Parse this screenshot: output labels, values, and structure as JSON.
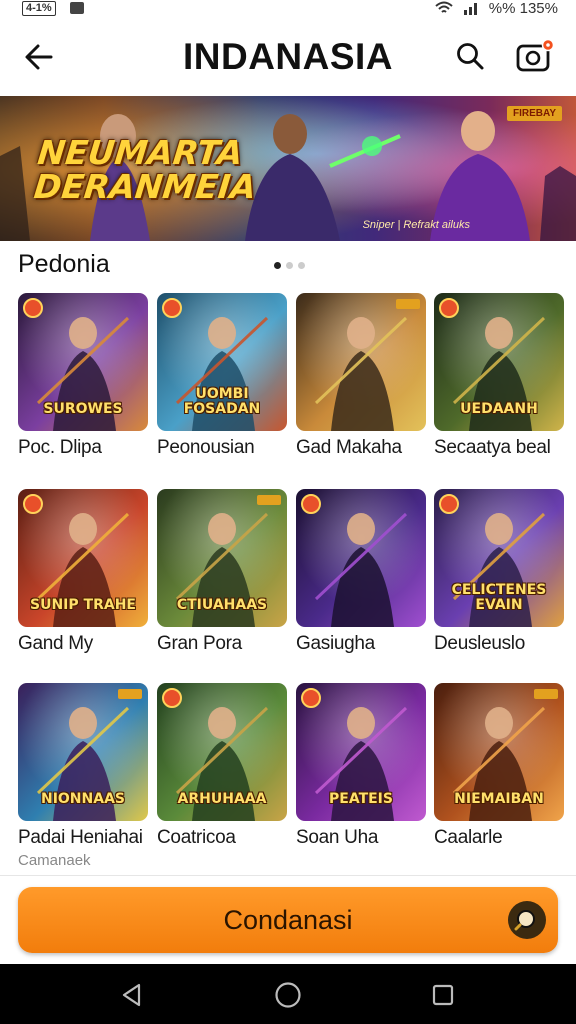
{
  "status_bar": {
    "left_indicator": "4-1%",
    "right_text": "%% 135%"
  },
  "header": {
    "title": "INDANASIA",
    "back_icon": "arrow-left-icon",
    "search_icon": "search-icon",
    "camera_icon": "camera-icon",
    "notification_color": "#f4511e"
  },
  "banner": {
    "title_line1": "NEUMARTA",
    "title_line2": "DERANMEIA",
    "badge": "FIREBAY",
    "caption": "Sniper | Refrakt ailuks"
  },
  "section": {
    "title": "Pedonia",
    "page_count": 3,
    "active_page": 1
  },
  "games": [
    {
      "name": "Poc. Dlipa",
      "thumb_title": "SUROWES",
      "colors": [
        "#2b1a3a",
        "#7b3fa0",
        "#d98a3a"
      ]
    },
    {
      "name": "Peonousian",
      "thumb_title": "UOMBI FOSADAN",
      "colors": [
        "#1f4f6a",
        "#4aa0c8",
        "#c8562e"
      ]
    },
    {
      "name": "Gad Makaha",
      "thumb_title": "",
      "colors": [
        "#3a2a1a",
        "#c98a3a",
        "#e3c25a"
      ]
    },
    {
      "name": "Secaatya beal",
      "thumb_title": "UEDAANH",
      "colors": [
        "#1e2b1a",
        "#4f6a2a",
        "#d0b44a"
      ]
    },
    {
      "name": "Gand My",
      "thumb_title": "SUNIP TRAHE",
      "colors": [
        "#5a1f14",
        "#c9452a",
        "#f0b03a"
      ]
    },
    {
      "name": "Gran Pora",
      "thumb_title": "CTIUAHAAS",
      "colors": [
        "#2a3a1e",
        "#6b8a3a",
        "#c9a447"
      ]
    },
    {
      "name": "Gasiugha",
      "thumb_title": "",
      "colors": [
        "#1b1030",
        "#4a2a8a",
        "#a04fd0"
      ]
    },
    {
      "name": "Deusleuslo",
      "thumb_title": "CELICTENES EVAIN",
      "colors": [
        "#2b1f4a",
        "#6a3fb0",
        "#e0a040"
      ]
    },
    {
      "name": "Padai Heniahai",
      "sub": "Camanaek",
      "thumb_title": "NIONNAAS",
      "colors": [
        "#3a1f5a",
        "#2f7fb0",
        "#e0c84a"
      ]
    },
    {
      "name": "Coatricoa",
      "thumb_title": "ARHUHAAA",
      "colors": [
        "#23401f",
        "#5a8a3a",
        "#c9a447"
      ]
    },
    {
      "name": "Soan Uha",
      "thumb_title": "PEATEIS",
      "colors": [
        "#2a1440",
        "#7a2aa0",
        "#c05ad0"
      ]
    },
    {
      "name": "Caalarle",
      "thumb_title": "NIEMAIBAN",
      "colors": [
        "#4a1e0e",
        "#b0521e",
        "#f0a44a"
      ]
    }
  ],
  "cta": {
    "label": "Condanasi",
    "icon": "search-icon"
  },
  "nav": {
    "back": "triangle-back-icon",
    "home": "circle-home-icon",
    "recents": "square-recents-icon"
  }
}
